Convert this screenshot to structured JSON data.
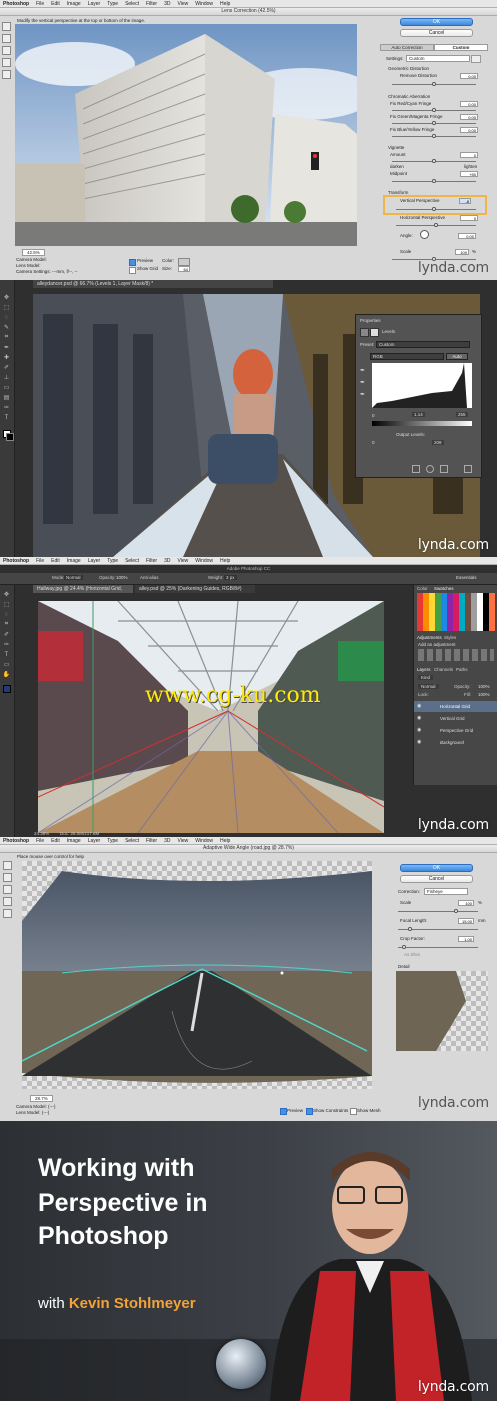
{
  "panel1": {
    "menubar": {
      "app": "Photoshop",
      "items": [
        "File",
        "Edit",
        "Image",
        "Layer",
        "Type",
        "Select",
        "Filter",
        "3D",
        "View",
        "Window",
        "Help"
      ]
    },
    "dialog_title": "Lens Correction (42.5%)",
    "hint": "Modify the vertical perspective at the top or bottom of the image.",
    "ok": "OK",
    "cancel": "Cancel",
    "tabs": [
      "Auto Correction",
      "Custom"
    ],
    "settings_label": "Settings:",
    "settings_value": "Custom",
    "sections": {
      "geometric": "Geometric Distortion",
      "remove_distortion": "Remove Distortion",
      "remove_distortion_val": "0.00",
      "chromatic": "Chromatic Aberration",
      "fix_red": "Fix Red/Cyan Fringe",
      "fix_red_val": "0.00",
      "fix_green": "Fix Green/Magenta Fringe",
      "fix_green_val": "0.00",
      "fix_blue": "Fix Blue/Yellow Fringe",
      "fix_blue_val": "0.00",
      "vignette": "Vignette",
      "amount": "Amount",
      "amount_val": "0",
      "darken": "darken",
      "lighten": "lighten",
      "midpoint": "Midpoint",
      "midpoint_val": "+50",
      "transform": "Transform",
      "vertical_perspective": "Vertical Perspective",
      "vertical_perspective_val": "-8",
      "horizontal_perspective": "Horizontal Perspective",
      "horizontal_perspective_val": "0",
      "angle": "Angle:",
      "angle_val": "0.00",
      "scale": "Scale",
      "scale_val": "100",
      "scale_unit": "%"
    },
    "zoom": "42.5%",
    "camera_model": "Camera Model:",
    "lens_model": "Lens Model:",
    "camera_settings": "Camera Settings: ---mm, f/--, --",
    "preview": "Preview",
    "show_grid": "Show Grid",
    "color_label": "Color:",
    "size_label": "Size:",
    "size_val": "64",
    "watermark": "lynda.com"
  },
  "panel2": {
    "doc_tab": "alleydancer.psd @ 66.7% (Levels 1, Layer Mask/8) *",
    "properties": {
      "title": "Properties",
      "type": "Levels",
      "preset_label": "Preset:",
      "preset_value": "Custom",
      "channel": "RGB",
      "auto": "Auto",
      "input_black": "0",
      "input_mid": "1.14",
      "input_white": "255",
      "output_label": "Output Levels:",
      "output_black": "0",
      "output_white": "209"
    },
    "watermark": "lynda.com"
  },
  "panel3": {
    "menubar": {
      "app": "Photoshop",
      "items": [
        "File",
        "Edit",
        "Image",
        "Layer",
        "Type",
        "Select",
        "Filter",
        "3D",
        "View",
        "Window",
        "Help"
      ]
    },
    "window_title": "Adobe Photoshop CC",
    "options": {
      "mode_label": "Mode:",
      "mode_value": "Normal",
      "opacity_label": "Opacity:",
      "opacity_value": "100%",
      "anti_alias": "Anti-alias",
      "weight_label": "Weight:",
      "weight_value": "3 px",
      "essentials": "Essentials"
    },
    "tabs": [
      "Hallway.jpg @ 24.4% (Horizontal Grid, RGB/8*) *",
      "alley.psd @ 25% (Darkening Guides, RGB/8#)"
    ],
    "status": "24.38%",
    "doc_size": "Doc: 28.0M/217.6M",
    "overlay_url": "www.cg-ku.com",
    "panels": {
      "color_tab": "Color",
      "swatches_tab": "Swatches",
      "adjustments_tab": "Adjustments",
      "styles_tab": "Styles",
      "add_adjustment": "Add an adjustment",
      "layers_tab": "Layers",
      "channels_tab": "Channels",
      "paths_tab": "Paths",
      "kind": "Kind",
      "blend": "Normal",
      "opacity_label": "Opacity:",
      "opacity_value": "100%",
      "lock_label": "Lock:",
      "fill_label": "Fill:",
      "fill_value": "100%",
      "layers": [
        "Horizontal Grid",
        "Vertical Grid",
        "Perspective Grid",
        "Background"
      ]
    },
    "watermark": "lynda.com"
  },
  "panel4": {
    "menubar": {
      "app": "Photoshop",
      "items": [
        "File",
        "Edit",
        "Image",
        "Layer",
        "Type",
        "Select",
        "Filter",
        "3D",
        "View",
        "Window",
        "Help"
      ]
    },
    "dialog_title": "Adaptive Wide Angle (road.jpg @ 28.7%)",
    "hint": "Place mouse over control for help",
    "ok": "OK",
    "cancel": "Cancel",
    "correction_label": "Correction:",
    "correction_value": "Fisheye",
    "scale_label": "Scale",
    "scale_value": "100",
    "scale_unit": "%",
    "focal_label": "Focal Length:",
    "focal_value": "15.00",
    "focal_unit": "mm",
    "crop_label": "Crop Factor:",
    "crop_value": "1.00",
    "as_shot": "As Shot",
    "detail": "Detail",
    "zoom": "28.7%",
    "camera_model": "Camera Model: (---)",
    "lens_model": "Lens Model: (---)",
    "preview": "Preview",
    "show_constraints": "Show Constraints",
    "show_mesh": "Show Mesh",
    "watermark": "lynda.com"
  },
  "panel5": {
    "title_line1": "Working with",
    "title_line2": "Perspective in",
    "title_line3": "Photoshop",
    "with_prefix": "with ",
    "author": "Kevin Stohlmeyer",
    "watermark": "lynda.com"
  },
  "colors": {
    "accent_orange": "#f2a33a",
    "highlight_field": "#f0b548",
    "ok_blue": "#3e88dd"
  }
}
